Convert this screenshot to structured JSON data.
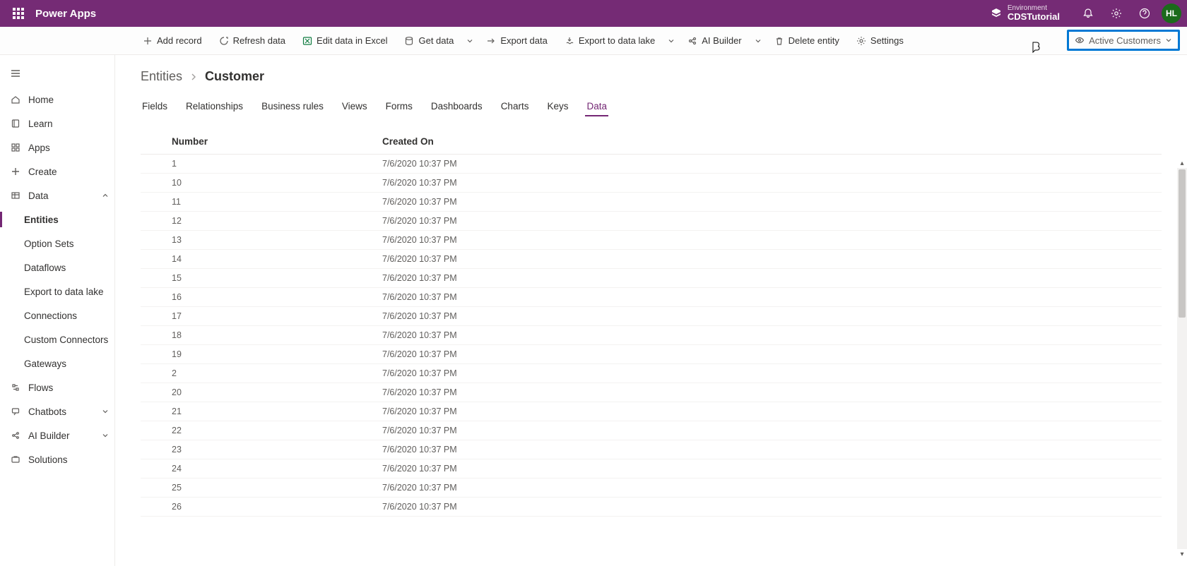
{
  "header": {
    "product_name": "Power Apps",
    "environment_label": "Environment",
    "environment_name": "CDSTutorial",
    "avatar_initials": "HL"
  },
  "command_bar": {
    "add_record": "Add record",
    "refresh_data": "Refresh data",
    "edit_in_excel": "Edit data in Excel",
    "get_data": "Get data",
    "export_data": "Export data",
    "export_to_lake": "Export to data lake",
    "ai_builder": "AI Builder",
    "delete_entity": "Delete entity",
    "settings": "Settings",
    "view_selector_label": "Active Customers"
  },
  "sidenav": {
    "home": "Home",
    "learn": "Learn",
    "apps": "Apps",
    "create": "Create",
    "data": "Data",
    "entities": "Entities",
    "option_sets": "Option Sets",
    "dataflows": "Dataflows",
    "export_lake": "Export to data lake",
    "connections": "Connections",
    "custom_connectors": "Custom Connectors",
    "gateways": "Gateways",
    "flows": "Flows",
    "chatbots": "Chatbots",
    "ai_builder": "AI Builder",
    "solutions": "Solutions"
  },
  "breadcrumb": {
    "root": "Entities",
    "leaf": "Customer"
  },
  "entity_tabs": {
    "fields": "Fields",
    "relationships": "Relationships",
    "business_rules": "Business rules",
    "views": "Views",
    "forms": "Forms",
    "dashboards": "Dashboards",
    "charts": "Charts",
    "keys": "Keys",
    "data": "Data"
  },
  "table": {
    "headers": {
      "number": "Number",
      "created_on": "Created On"
    },
    "rows": [
      {
        "number": "1",
        "created_on": "7/6/2020 10:37 PM"
      },
      {
        "number": "10",
        "created_on": "7/6/2020 10:37 PM"
      },
      {
        "number": "11",
        "created_on": "7/6/2020 10:37 PM"
      },
      {
        "number": "12",
        "created_on": "7/6/2020 10:37 PM"
      },
      {
        "number": "13",
        "created_on": "7/6/2020 10:37 PM"
      },
      {
        "number": "14",
        "created_on": "7/6/2020 10:37 PM"
      },
      {
        "number": "15",
        "created_on": "7/6/2020 10:37 PM"
      },
      {
        "number": "16",
        "created_on": "7/6/2020 10:37 PM"
      },
      {
        "number": "17",
        "created_on": "7/6/2020 10:37 PM"
      },
      {
        "number": "18",
        "created_on": "7/6/2020 10:37 PM"
      },
      {
        "number": "19",
        "created_on": "7/6/2020 10:37 PM"
      },
      {
        "number": "2",
        "created_on": "7/6/2020 10:37 PM"
      },
      {
        "number": "20",
        "created_on": "7/6/2020 10:37 PM"
      },
      {
        "number": "21",
        "created_on": "7/6/2020 10:37 PM"
      },
      {
        "number": "22",
        "created_on": "7/6/2020 10:37 PM"
      },
      {
        "number": "23",
        "created_on": "7/6/2020 10:37 PM"
      },
      {
        "number": "24",
        "created_on": "7/6/2020 10:37 PM"
      },
      {
        "number": "25",
        "created_on": "7/6/2020 10:37 PM"
      },
      {
        "number": "26",
        "created_on": "7/6/2020 10:37 PM"
      }
    ]
  }
}
